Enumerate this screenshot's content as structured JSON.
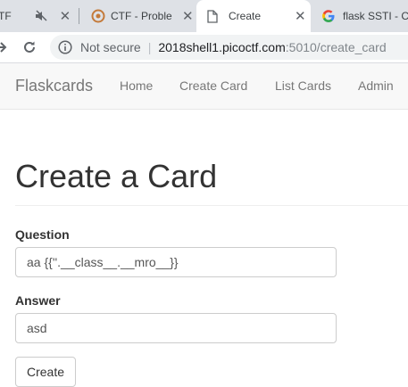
{
  "browser": {
    "tabs": [
      {
        "title": "TF",
        "state": "partial",
        "muted": true
      },
      {
        "title": "CTF - Proble",
        "state": "inactive"
      },
      {
        "title": "Create",
        "state": "active"
      },
      {
        "title": "flask SSTI - C",
        "state": "inactive"
      }
    ],
    "address": {
      "security_label": "Not secure",
      "host": "2018shell1.picoctf.com",
      "path": ":5010/create_card"
    }
  },
  "navbar": {
    "brand": "Flaskcards",
    "links": [
      "Home",
      "Create Card",
      "List Cards",
      "Admin"
    ]
  },
  "main": {
    "heading": "Create a Card",
    "question_label": "Question",
    "question_value": "aa {{''.__class__.__mro__}}",
    "answer_label": "Answer",
    "answer_value": "asd",
    "submit_label": "Create"
  },
  "colors": {
    "tabstrip": "#dee1e6",
    "navbar_bg": "#f8f8f8",
    "nav_text": "#777777",
    "heading": "#333333"
  }
}
